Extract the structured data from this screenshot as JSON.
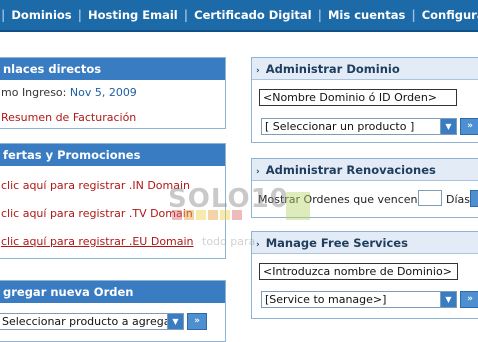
{
  "nav": {
    "items": [
      "Dominios",
      "Hosting Email",
      "Certificado Digital",
      "Mis cuentas",
      "Configuraciones"
    ]
  },
  "left": {
    "quick_links": {
      "title": "nlaces directos",
      "last_login_label": "mo Ingreso:",
      "last_login_value": "Nov 5, 2009",
      "billing_link": "Resumen de Facturación"
    },
    "offers": {
      "title": "fertas y Promociones",
      "links": [
        "clic aquí para registrar .IN Domain",
        "clic aquí para registrar .TV Domain",
        "clic aquí para registrar .EU Domain"
      ]
    },
    "new_order": {
      "title": "gregar nueva Orden",
      "select_value": "Seleccionar producto a agrega",
      "go": "»"
    }
  },
  "right": {
    "manage_domain": {
      "title": "Administrar Dominio",
      "input_value": "<Nombre Dominio ó ID Orden>",
      "select_value": "[ Seleccionar un producto ]",
      "go": "»"
    },
    "renewals": {
      "title": "Administrar Renovaciones",
      "label_prefix": "Mostrar Ordenes que vencen en",
      "label_suffix": "Días",
      "go": "»"
    },
    "free_services": {
      "title": "Manage Free Services",
      "input_value": "<Introduzca nombre de Dominio>",
      "select_value": "[Service to manage>]",
      "go": "»"
    }
  },
  "watermark": {
    "text": "SOLO10",
    "sub": "todo para"
  },
  "colors": {
    "nav_bg": "#1d6aa8",
    "panel_header": "#3a7cc1",
    "light_header": "#e3ecf6",
    "link_red": "#b01818",
    "value_blue": "#1f5fa3"
  }
}
